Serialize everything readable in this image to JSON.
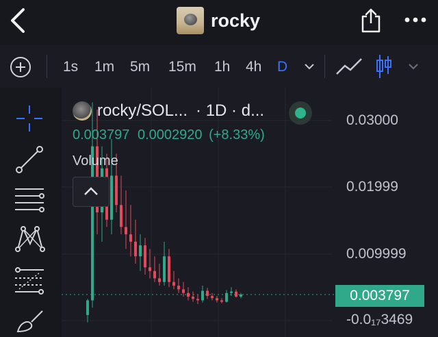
{
  "header": {
    "title": "rocky",
    "back_icon": "chevron-left-icon",
    "share_icon": "share-icon",
    "more_icon": "more-horizontal-icon"
  },
  "toolbar": {
    "timeframes": [
      "1s",
      "1m",
      "5m",
      "15m",
      "1h",
      "4h",
      "D"
    ],
    "active_timeframe": "D",
    "chart_type_icons": [
      "line-chart-icon",
      "candlestick-icon"
    ]
  },
  "chart_legend": {
    "symbol": "rocky/SOL...",
    "interval_text": "· 1D · d...",
    "price": "0.003797",
    "change": "0.0002920",
    "change_percent": "(+8.33%)",
    "volume_label": "Volume"
  },
  "yaxis": {
    "labels": [
      "0.03000",
      "0.01999",
      "0.009999",
      "0.003797",
      "-0.0₁₇3469"
    ],
    "current_price": "0.003797"
  },
  "colors": {
    "up": "#2fa98a",
    "down": "#e04a5a",
    "accent": "#3a72ff"
  },
  "chart_data": {
    "type": "candlestick",
    "series": [
      {
        "values": [
          {
            "o": 0.001,
            "h": 0.0032,
            "l": 0.0,
            "c": 0.003
          },
          {
            "o": 0.003,
            "h": 0.03,
            "l": 0.002,
            "c": 0.024
          },
          {
            "o": 0.024,
            "h": 0.029,
            "l": 0.012,
            "c": 0.015
          },
          {
            "o": 0.015,
            "h": 0.024,
            "l": 0.011,
            "c": 0.021
          },
          {
            "o": 0.021,
            "h": 0.023,
            "l": 0.013,
            "c": 0.014
          },
          {
            "o": 0.014,
            "h": 0.025,
            "l": 0.012,
            "c": 0.02
          },
          {
            "o": 0.02,
            "h": 0.023,
            "l": 0.015,
            "c": 0.016
          },
          {
            "o": 0.016,
            "h": 0.02,
            "l": 0.012,
            "c": 0.013
          },
          {
            "o": 0.013,
            "h": 0.018,
            "l": 0.01,
            "c": 0.012
          },
          {
            "o": 0.012,
            "h": 0.016,
            "l": 0.009,
            "c": 0.011
          },
          {
            "o": 0.011,
            "h": 0.014,
            "l": 0.008,
            "c": 0.009
          },
          {
            "o": 0.009,
            "h": 0.012,
            "l": 0.007,
            "c": 0.0105
          },
          {
            "o": 0.0105,
            "h": 0.0115,
            "l": 0.0065,
            "c": 0.0075
          },
          {
            "o": 0.0075,
            "h": 0.01,
            "l": 0.006,
            "c": 0.007
          },
          {
            "o": 0.007,
            "h": 0.009,
            "l": 0.0055,
            "c": 0.006
          },
          {
            "o": 0.006,
            "h": 0.008,
            "l": 0.005,
            "c": 0.0055
          },
          {
            "o": 0.0055,
            "h": 0.011,
            "l": 0.005,
            "c": 0.009
          },
          {
            "o": 0.009,
            "h": 0.01,
            "l": 0.0048,
            "c": 0.0055
          },
          {
            "o": 0.0055,
            "h": 0.007,
            "l": 0.0045,
            "c": 0.005
          },
          {
            "o": 0.005,
            "h": 0.006,
            "l": 0.004,
            "c": 0.0045
          },
          {
            "o": 0.0045,
            "h": 0.0055,
            "l": 0.0035,
            "c": 0.004
          },
          {
            "o": 0.004,
            "h": 0.0048,
            "l": 0.003,
            "c": 0.0035
          },
          {
            "o": 0.0035,
            "h": 0.0042,
            "l": 0.0028,
            "c": 0.0032
          },
          {
            "o": 0.0032,
            "h": 0.0038,
            "l": 0.0025,
            "c": 0.003
          },
          {
            "o": 0.003,
            "h": 0.005,
            "l": 0.0027,
            "c": 0.0043
          },
          {
            "o": 0.0043,
            "h": 0.0047,
            "l": 0.0032,
            "c": 0.0036
          },
          {
            "o": 0.0036,
            "h": 0.004,
            "l": 0.003,
            "c": 0.0033
          },
          {
            "o": 0.0033,
            "h": 0.0036,
            "l": 0.0027,
            "c": 0.003
          },
          {
            "o": 0.003,
            "h": 0.0033,
            "l": 0.0026,
            "c": 0.0028
          },
          {
            "o": 0.0028,
            "h": 0.0044,
            "l": 0.0027,
            "c": 0.004
          },
          {
            "o": 0.004,
            "h": 0.0048,
            "l": 0.0036,
            "c": 0.0042
          },
          {
            "o": 0.0042,
            "h": 0.0045,
            "l": 0.0034,
            "c": 0.0035
          },
          {
            "o": 0.0035,
            "h": 0.004,
            "l": 0.0033,
            "c": 0.0038
          }
        ]
      }
    ],
    "ylim": [
      -0.002,
      0.032
    ],
    "grid": true
  }
}
